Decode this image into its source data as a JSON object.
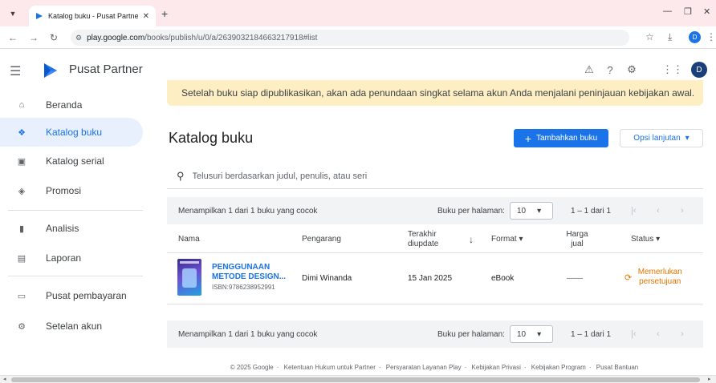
{
  "browser": {
    "tab_title": "Katalog buku - Pusat Partner G",
    "tab_close": "✕",
    "new_tab": "+",
    "url_host": "play.google.com",
    "url_path": "/books/publish/u/0/a/2639032184663217918#list",
    "profile_initial": "D"
  },
  "header": {
    "brand": "Pusat Partner",
    "avatar_initial": "D"
  },
  "sidebar": {
    "items": [
      {
        "label": "Beranda",
        "icon": "home-icon"
      },
      {
        "label": "Katalog buku",
        "icon": "book-icon"
      },
      {
        "label": "Katalog serial",
        "icon": "series-icon"
      },
      {
        "label": "Promosi",
        "icon": "tag-icon"
      },
      {
        "label": "Analisis",
        "icon": "bar-chart-icon"
      },
      {
        "label": "Laporan",
        "icon": "report-icon"
      },
      {
        "label": "Pusat pembayaran",
        "icon": "payment-card-icon"
      },
      {
        "label": "Setelan akun",
        "icon": "gear-icon"
      }
    ]
  },
  "main": {
    "notice": "Setelah buku siap dipublikasikan, akan ada penundaan singkat selama akun Anda menjalani peninjauan kebijakan awal.",
    "title": "Katalog buku",
    "add_button": "Tambahkan buku",
    "options_button": "Opsi lanjutan",
    "search_placeholder": "Telusuri berdasarkan judul, penulis, atau seri",
    "pager": {
      "showing": "Menampilkan 1 dari 1 buku yang cocok",
      "per_page_label": "Buku per halaman:",
      "per_page_value": "10",
      "range": "1 – 1 dari 1"
    },
    "columns": {
      "name": "Nama",
      "author": "Pengarang",
      "updated": "Terakhir diupdate",
      "format": "Format",
      "price": "Harga jual",
      "status": "Status"
    },
    "rows": [
      {
        "title": "PENGGUNAAN METODE DESIGN...",
        "isbn": "ISBN:9786238952991",
        "author": "Dimi Winanda",
        "updated": "15 Jan 2025",
        "format": "eBook",
        "price": "——",
        "status": "Memerlukan persetujuan"
      }
    ]
  },
  "footer": {
    "links": [
      "© 2025 Google",
      "Ketentuan Hukum untuk Partner",
      "Persyaratan Layanan Play",
      "Kebijakan Privasi",
      "Kebijakan Program",
      "Pusat Bantuan"
    ]
  },
  "colors": {
    "accent": "#1a73e8",
    "notice_bg": "#fdefc3",
    "status_warning": "#e37400",
    "tabbar_bg": "#fde8ec"
  }
}
